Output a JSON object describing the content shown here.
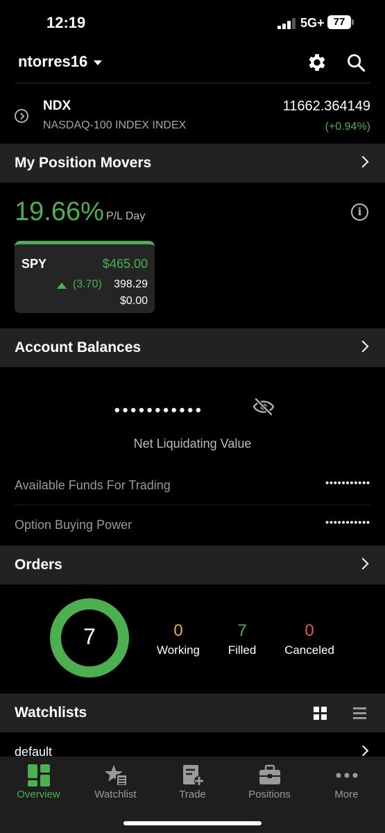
{
  "status_bar": {
    "time": "12:19",
    "network": "5G+",
    "battery": "77"
  },
  "header": {
    "username": "ntorres16",
    "icons": [
      "caret-down-icon",
      "gear-icon",
      "search-icon"
    ]
  },
  "index_row": {
    "symbol": "NDX",
    "description": "NASDAQ-100 INDEX INDEX",
    "price": "11662.364149",
    "change": "(+0.94%)"
  },
  "position_movers": {
    "title": "My Position Movers",
    "pl_percent": "19.66%",
    "pl_label": "P/L Day",
    "card": {
      "symbol": "SPY",
      "value": "$465.00",
      "delta": "(3.70)",
      "last": "398.29",
      "pnl": "$0.00"
    }
  },
  "account_balances": {
    "title": "Account Balances",
    "masked_value": "•••••••••••",
    "nlv_label": "Net Liquidating Value",
    "rows": [
      {
        "label": "Available Funds For Trading",
        "value": "•••••••••••"
      },
      {
        "label": "Option Buying Power",
        "value": "•••••••••••"
      }
    ]
  },
  "orders": {
    "title": "Orders",
    "total": "7",
    "stats": [
      {
        "count": "0",
        "label": "Working",
        "color": "#e8a94e"
      },
      {
        "count": "7",
        "label": "Filled",
        "color": "#4caf50"
      },
      {
        "count": "0",
        "label": "Canceled",
        "color": "#e8574e"
      }
    ]
  },
  "watchlists": {
    "title": "Watchlists",
    "first": "default"
  },
  "tabs": [
    {
      "label": "Overview",
      "icon": "overview-icon",
      "active": true
    },
    {
      "label": "Watchlist",
      "icon": "watchlist-icon",
      "active": false
    },
    {
      "label": "Trade",
      "icon": "trade-icon",
      "active": false
    },
    {
      "label": "Positions",
      "icon": "positions-icon",
      "active": false
    },
    {
      "label": "More",
      "icon": "more-icon",
      "active": false
    }
  ],
  "colors": {
    "accent_green": "#4caf50",
    "section_bg": "#222222",
    "background": "#000000"
  }
}
